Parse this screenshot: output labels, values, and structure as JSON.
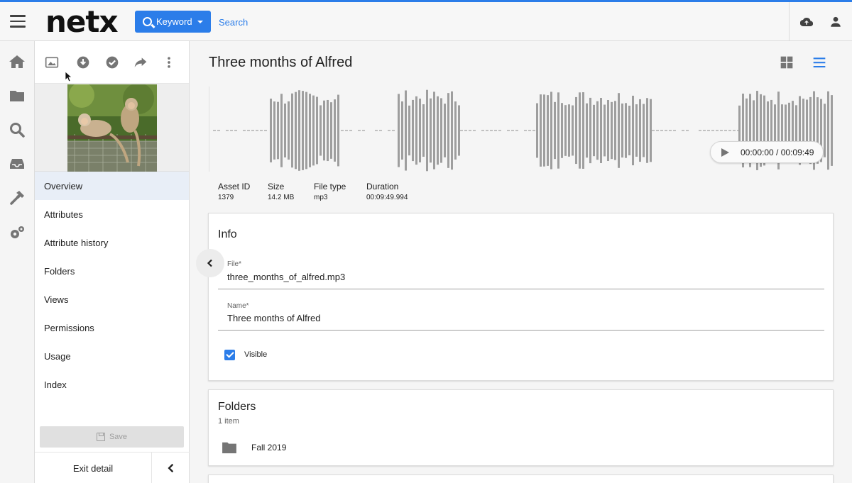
{
  "topbar": {
    "logo": "netx",
    "keyword_button": "Keyword",
    "search_placeholder": "Search"
  },
  "rail": {
    "items": [
      "home-icon",
      "folder-icon",
      "search-icon",
      "inbox-icon",
      "hammer-icon",
      "gears-icon"
    ]
  },
  "side": {
    "toolbar": [
      "image-icon",
      "download-icon",
      "check-circle-icon",
      "share-icon",
      "more-vertical-icon"
    ],
    "nav": [
      {
        "label": "Overview",
        "active": true
      },
      {
        "label": "Attributes"
      },
      {
        "label": "Attribute history"
      },
      {
        "label": "Folders"
      },
      {
        "label": "Views"
      },
      {
        "label": "Permissions"
      },
      {
        "label": "Usage"
      },
      {
        "label": "Index"
      }
    ],
    "save_label": "Save",
    "exit_label": "Exit detail"
  },
  "main": {
    "title": "Three months of Alfred",
    "player_time": "00:00:00 / 00:09:49",
    "meta": [
      {
        "label": "Asset ID",
        "value": "1379"
      },
      {
        "label": "Size",
        "value": "14.2 MB"
      },
      {
        "label": "File type",
        "value": "mp3"
      },
      {
        "label": "Duration",
        "value": "00:09:49.994"
      }
    ],
    "info": {
      "title": "Info",
      "file_label": "File*",
      "file_value": "three_months_of_alfred.mp3",
      "name_label": "Name*",
      "name_value": "Three months of Alfred",
      "visible_label": "Visible",
      "visible_checked": true
    },
    "folders": {
      "title": "Folders",
      "count": "1 item",
      "items": [
        "Fall 2019"
      ]
    }
  },
  "colors": {
    "accent": "#2b7de9",
    "waveform": "#9e9e9e"
  }
}
